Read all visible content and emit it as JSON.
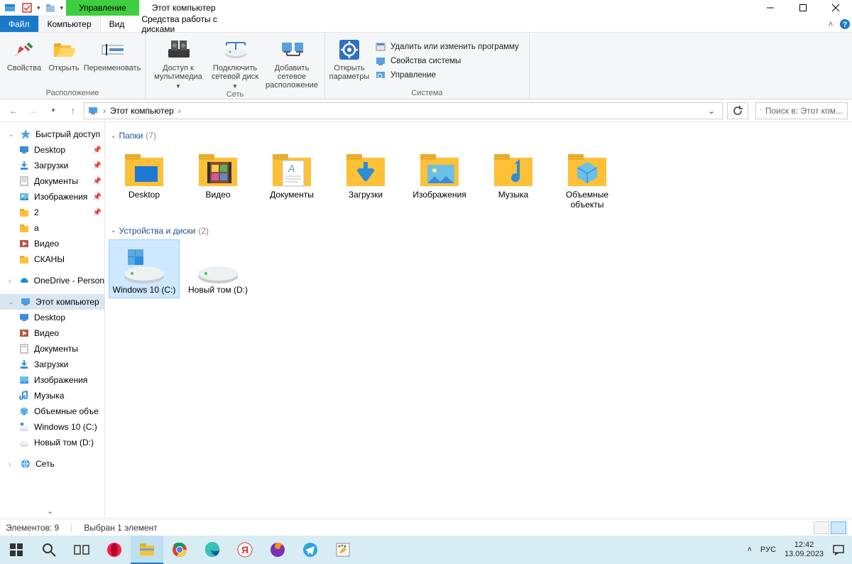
{
  "window": {
    "title": "Этот компьютер",
    "contextual_tab": "Управление"
  },
  "tabs": {
    "file": "Файл",
    "computer": "Компьютер",
    "view": "Вид",
    "manage": "Средства работы с дисками"
  },
  "ribbon": {
    "location": {
      "label": "Расположение",
      "props": "Свойства",
      "open": "Открыть",
      "rename": "Переименовать"
    },
    "network": {
      "label": "Сеть",
      "media": "Доступ к мультимедиа",
      "map": "Подключить сетевой диск",
      "addloc": "Добавить сетевое расположение"
    },
    "system": {
      "label": "Система",
      "settings": "Открыть параметры",
      "uninstall": "Удалить или изменить программу",
      "sysprops": "Свойства системы",
      "manage": "Управление"
    }
  },
  "addr": {
    "root": "Этот компьютер"
  },
  "search": {
    "placeholder": "Поиск в: Этот ком..."
  },
  "tree": {
    "quick": "Быстрый доступ",
    "desktop": "Desktop",
    "downloads": "Загрузки",
    "documents": "Документы",
    "pictures": "Изображения",
    "two": "2",
    "a": "a",
    "video": "Видео",
    "scans": "СКАНЫ",
    "onedrive": "OneDrive - Person",
    "thispc": "Этот компьютер",
    "pc_desktop": "Desktop",
    "pc_video": "Видео",
    "pc_docs": "Документы",
    "pc_downloads": "Загрузки",
    "pc_pictures": "Изображения",
    "pc_music": "Музыка",
    "pc_3d": "Объемные объе",
    "pc_c": "Windows 10 (C:)",
    "pc_d": "Новый том (D:)",
    "network": "Сеть"
  },
  "content": {
    "folders_head": "Папки",
    "folders_count": "(7)",
    "drives_head": "Устройства и диски",
    "drives_count": "(2)",
    "items": {
      "desktop": "Desktop",
      "video": "Видео",
      "docs": "Документы",
      "downloads": "Загрузки",
      "pictures": "Изображения",
      "music": "Музыка",
      "objects3d": "Объемные объекты",
      "c": "Windows 10 (C:)",
      "d": "Новый том (D:)"
    }
  },
  "status": {
    "count": "Элементов: 9",
    "selection": "Выбран 1 элемент"
  },
  "taskbar": {
    "lang": "РУС",
    "time": "12:42",
    "date": "13.09.2023"
  }
}
